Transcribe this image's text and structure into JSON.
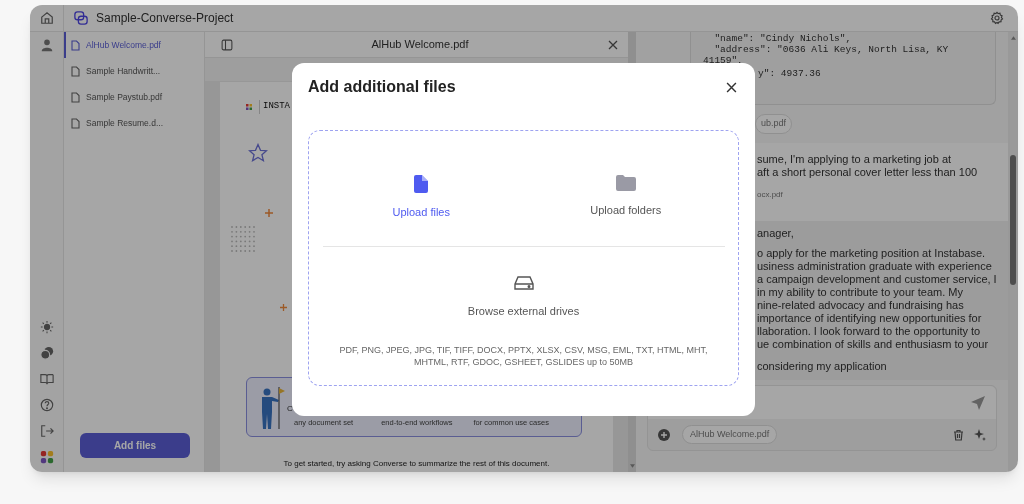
{
  "top_bar": {
    "project_title": "Sample-Converse-Project"
  },
  "files": [
    {
      "name": "AlHub Welcome.pdf",
      "selected": true
    },
    {
      "name": "Sample Handwritt...",
      "selected": false
    },
    {
      "name": "Sample Paystub.pdf",
      "selected": false
    },
    {
      "name": "Sample Resume.d...",
      "selected": false
    }
  ],
  "add_files_button": "Add files",
  "document": {
    "title": "AlHub Welcome.pdf",
    "logo_text": "INSTA",
    "card_fragment": "C",
    "card_captions": [
      "any document set",
      "end-to-end workflows",
      "for common use cases"
    ],
    "footer": "To get started, try asking Converse to summarize the rest of this document."
  },
  "chat": {
    "code_lines": [
      "  \"name\": \"Cindy Nichols\",",
      "  \"address\": \"0636 Ali Keys, North Lisa, KY",
      "41159\","
    ],
    "code_fragment": "y\": 4937.36",
    "attachment_fragment": "ub.pdf",
    "message_lines": [
      "sume, I'm applying to a marketing job at",
      "aft a short personal cover letter less than 100"
    ],
    "message_attachment": "ocx.pdf",
    "reply_lines": [
      "anager,",
      "o apply for the marketing position at Instabase.",
      "usiness administration graduate with experience",
      "a campaign development and customer service, I",
      "in my ability to contribute to your team. My",
      "nine-related advocacy and fundraising has",
      "importance of identifying new opportunities for",
      "llaboration. I look forward to the opportunity to",
      "ue combination of skills and enthusiasm to your",
      "considering my application"
    ],
    "input_attachment": "AlHub Welcome.pdf"
  },
  "modal": {
    "title": "Add additional files",
    "options": [
      {
        "kind": "file",
        "label": "Upload files",
        "selected": true
      },
      {
        "kind": "folder",
        "label": "Upload folders",
        "selected": false
      }
    ],
    "browse_label": "Browse external drives",
    "formats": "PDF, PNG, JPEG, JPG, TIF, TIFF, DOCX, PPTX, XLSX, CSV, MSG, EML, TXT, HTML, MHT, MHTML, RTF, GDOC, GSHEET, GSLIDES up to 50MB"
  }
}
